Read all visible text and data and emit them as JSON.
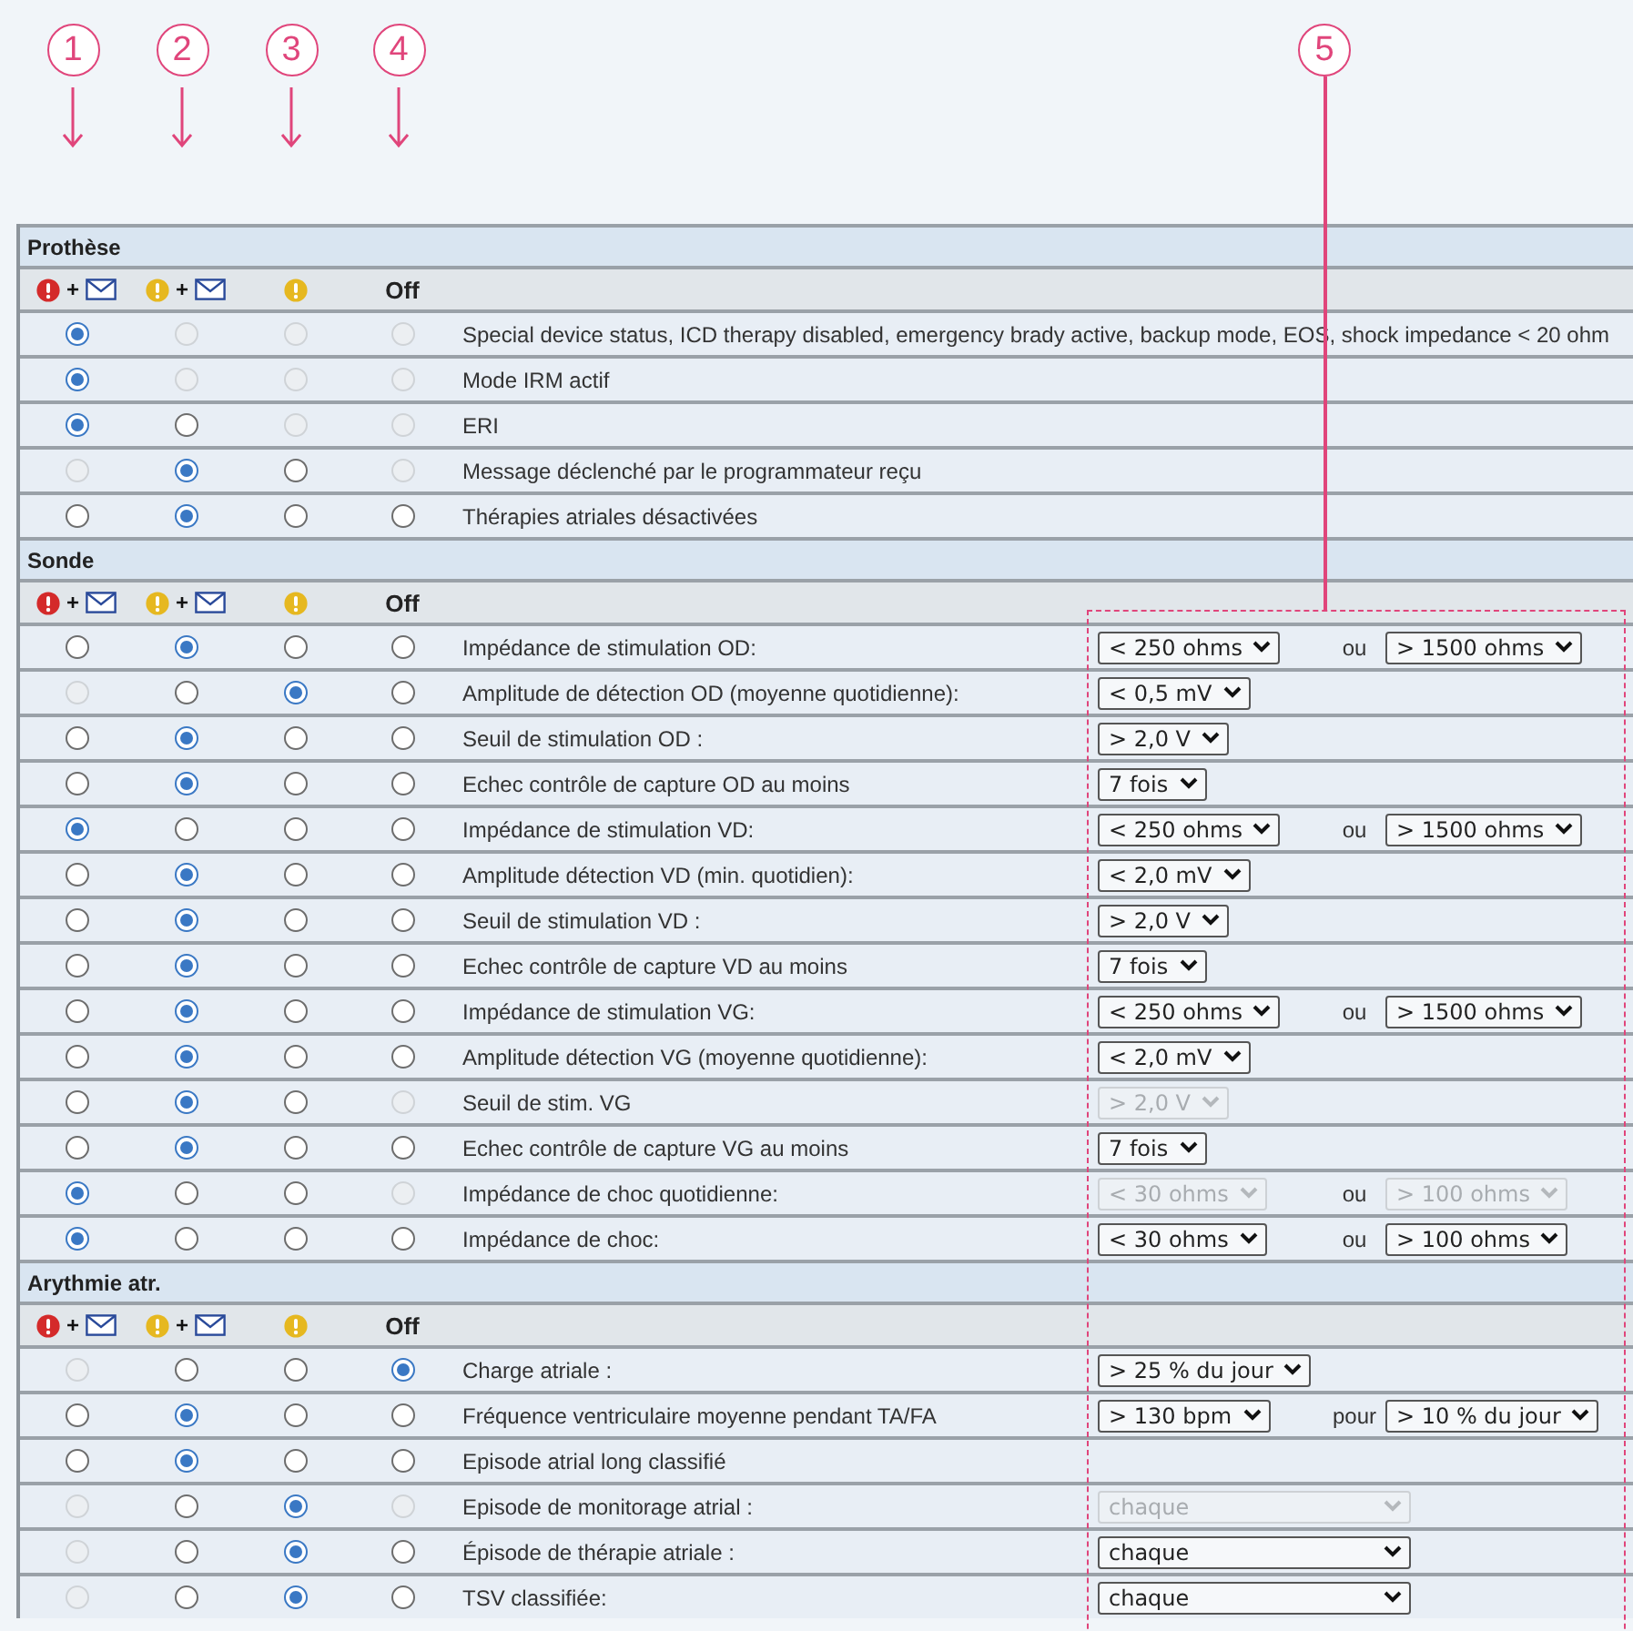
{
  "callouts": [
    {
      "number": "1",
      "kind": "arrow"
    },
    {
      "number": "2",
      "kind": "arrow"
    },
    {
      "number": "3",
      "kind": "arrow"
    },
    {
      "number": "4",
      "kind": "arrow"
    },
    {
      "number": "5",
      "kind": "frame"
    }
  ],
  "sections": [
    {
      "title": "Prothèse",
      "columns": [
        {
          "kind": "urgent-mail",
          "plus": "+"
        },
        {
          "kind": "warning-mail",
          "plus": "+"
        },
        {
          "kind": "warning"
        },
        {
          "kind": "text",
          "label": "Off"
        }
      ],
      "rows": [
        {
          "label": "Special device status, ICD therapy disabled, emergency brady active, backup mode, EOS, shock impedance < 20 ohm",
          "options": [
            {
              "selected": true,
              "disabled": false
            },
            {
              "selected": false,
              "disabled": true
            },
            {
              "selected": false,
              "disabled": true
            },
            {
              "selected": false,
              "disabled": true
            }
          ],
          "controls": []
        },
        {
          "label": "Mode IRM actif",
          "options": [
            {
              "selected": true,
              "disabled": false
            },
            {
              "selected": false,
              "disabled": true
            },
            {
              "selected": false,
              "disabled": true
            },
            {
              "selected": false,
              "disabled": true
            }
          ],
          "controls": []
        },
        {
          "label": "ERI",
          "options": [
            {
              "selected": true,
              "disabled": false
            },
            {
              "selected": false,
              "disabled": false
            },
            {
              "selected": false,
              "disabled": true
            },
            {
              "selected": false,
              "disabled": true
            }
          ],
          "controls": []
        },
        {
          "label": "Message déclenché par le programmateur reçu",
          "options": [
            {
              "selected": false,
              "disabled": true
            },
            {
              "selected": true,
              "disabled": false
            },
            {
              "selected": false,
              "disabled": false
            },
            {
              "selected": false,
              "disabled": true
            }
          ],
          "controls": []
        },
        {
          "label": "Thérapies atriales désactivées",
          "options": [
            {
              "selected": false,
              "disabled": false
            },
            {
              "selected": true,
              "disabled": false
            },
            {
              "selected": false,
              "disabled": false
            },
            {
              "selected": false,
              "disabled": false
            }
          ],
          "controls": []
        }
      ]
    },
    {
      "title": "Sonde",
      "columns": [
        {
          "kind": "urgent-mail",
          "plus": "+"
        },
        {
          "kind": "warning-mail",
          "plus": "+"
        },
        {
          "kind": "warning"
        },
        {
          "kind": "text",
          "label": "Off"
        }
      ],
      "rows": [
        {
          "label": "Impédance de stimulation OD:",
          "options": [
            {
              "selected": false,
              "disabled": false
            },
            {
              "selected": true,
              "disabled": false
            },
            {
              "selected": false,
              "disabled": false
            },
            {
              "selected": false,
              "disabled": false
            }
          ],
          "controls": [
            {
              "kind": "select",
              "value": "< 250 ohms",
              "disabled": false
            },
            {
              "kind": "text",
              "label": "ou"
            },
            {
              "kind": "select",
              "value": "> 1500 ohms",
              "disabled": false
            }
          ]
        },
        {
          "label": "Amplitude de détection OD (moyenne quotidienne):",
          "options": [
            {
              "selected": false,
              "disabled": true
            },
            {
              "selected": false,
              "disabled": false
            },
            {
              "selected": true,
              "disabled": false
            },
            {
              "selected": false,
              "disabled": false
            }
          ],
          "controls": [
            {
              "kind": "select",
              "value": "< 0,5 mV",
              "disabled": false
            }
          ]
        },
        {
          "label": "Seuil de stimulation OD :",
          "options": [
            {
              "selected": false,
              "disabled": false
            },
            {
              "selected": true,
              "disabled": false
            },
            {
              "selected": false,
              "disabled": false
            },
            {
              "selected": false,
              "disabled": false
            }
          ],
          "controls": [
            {
              "kind": "select",
              "value": "> 2,0 V",
              "disabled": false
            }
          ]
        },
        {
          "label": "Echec contrôle de capture OD au moins",
          "options": [
            {
              "selected": false,
              "disabled": false
            },
            {
              "selected": true,
              "disabled": false
            },
            {
              "selected": false,
              "disabled": false
            },
            {
              "selected": false,
              "disabled": false
            }
          ],
          "controls": [
            {
              "kind": "select",
              "value": "7 fois",
              "disabled": false
            }
          ]
        },
        {
          "label": "Impédance de stimulation VD:",
          "options": [
            {
              "selected": true,
              "disabled": false
            },
            {
              "selected": false,
              "disabled": false
            },
            {
              "selected": false,
              "disabled": false
            },
            {
              "selected": false,
              "disabled": false
            }
          ],
          "controls": [
            {
              "kind": "select",
              "value": "< 250 ohms",
              "disabled": false
            },
            {
              "kind": "text",
              "label": "ou"
            },
            {
              "kind": "select",
              "value": "> 1500 ohms",
              "disabled": false
            }
          ]
        },
        {
          "label": "Amplitude détection VD (min. quotidien):",
          "options": [
            {
              "selected": false,
              "disabled": false
            },
            {
              "selected": true,
              "disabled": false
            },
            {
              "selected": false,
              "disabled": false
            },
            {
              "selected": false,
              "disabled": false
            }
          ],
          "controls": [
            {
              "kind": "select",
              "value": "< 2,0 mV",
              "disabled": false
            }
          ]
        },
        {
          "label": "Seuil de stimulation VD :",
          "options": [
            {
              "selected": false,
              "disabled": false
            },
            {
              "selected": true,
              "disabled": false
            },
            {
              "selected": false,
              "disabled": false
            },
            {
              "selected": false,
              "disabled": false
            }
          ],
          "controls": [
            {
              "kind": "select",
              "value": "> 2,0 V",
              "disabled": false
            }
          ]
        },
        {
          "label": "Echec contrôle de capture VD au moins",
          "options": [
            {
              "selected": false,
              "disabled": false
            },
            {
              "selected": true,
              "disabled": false
            },
            {
              "selected": false,
              "disabled": false
            },
            {
              "selected": false,
              "disabled": false
            }
          ],
          "controls": [
            {
              "kind": "select",
              "value": "7 fois",
              "disabled": false
            }
          ]
        },
        {
          "label": "Impédance de stimulation VG:",
          "options": [
            {
              "selected": false,
              "disabled": false
            },
            {
              "selected": true,
              "disabled": false
            },
            {
              "selected": false,
              "disabled": false
            },
            {
              "selected": false,
              "disabled": false
            }
          ],
          "controls": [
            {
              "kind": "select",
              "value": "< 250 ohms",
              "disabled": false
            },
            {
              "kind": "text",
              "label": "ou"
            },
            {
              "kind": "select",
              "value": "> 1500 ohms",
              "disabled": false
            }
          ]
        },
        {
          "label": "Amplitude détection VG (moyenne quotidienne):",
          "options": [
            {
              "selected": false,
              "disabled": false
            },
            {
              "selected": true,
              "disabled": false
            },
            {
              "selected": false,
              "disabled": false
            },
            {
              "selected": false,
              "disabled": false
            }
          ],
          "controls": [
            {
              "kind": "select",
              "value": "< 2,0 mV",
              "disabled": false
            }
          ]
        },
        {
          "label": "Seuil de stim. VG",
          "options": [
            {
              "selected": false,
              "disabled": false
            },
            {
              "selected": true,
              "disabled": false
            },
            {
              "selected": false,
              "disabled": false
            },
            {
              "selected": false,
              "disabled": true
            }
          ],
          "controls": [
            {
              "kind": "select",
              "value": "> 2,0 V",
              "disabled": true
            }
          ]
        },
        {
          "label": "Echec contrôle de capture VG au moins",
          "options": [
            {
              "selected": false,
              "disabled": false
            },
            {
              "selected": true,
              "disabled": false
            },
            {
              "selected": false,
              "disabled": false
            },
            {
              "selected": false,
              "disabled": false
            }
          ],
          "controls": [
            {
              "kind": "select",
              "value": "7 fois",
              "disabled": false
            }
          ]
        },
        {
          "label": "Impédance de choc quotidienne:",
          "options": [
            {
              "selected": true,
              "disabled": false
            },
            {
              "selected": false,
              "disabled": false
            },
            {
              "selected": false,
              "disabled": false
            },
            {
              "selected": false,
              "disabled": true
            }
          ],
          "controls": [
            {
              "kind": "select",
              "value": "< 30 ohms",
              "disabled": true
            },
            {
              "kind": "text",
              "label": "ou"
            },
            {
              "kind": "select",
              "value": "> 100 ohms",
              "disabled": true
            }
          ]
        },
        {
          "label": "Impédance de choc:",
          "options": [
            {
              "selected": true,
              "disabled": false
            },
            {
              "selected": false,
              "disabled": false
            },
            {
              "selected": false,
              "disabled": false
            },
            {
              "selected": false,
              "disabled": false
            }
          ],
          "controls": [
            {
              "kind": "select",
              "value": "< 30 ohms",
              "disabled": false
            },
            {
              "kind": "text",
              "label": "ou"
            },
            {
              "kind": "select",
              "value": "> 100 ohms",
              "disabled": false
            }
          ]
        }
      ]
    },
    {
      "title": "Arythmie atr.",
      "columns": [
        {
          "kind": "urgent-mail",
          "plus": "+"
        },
        {
          "kind": "warning-mail",
          "plus": "+"
        },
        {
          "kind": "warning"
        },
        {
          "kind": "text",
          "label": "Off"
        }
      ],
      "rows": [
        {
          "label": "Charge atriale :",
          "options": [
            {
              "selected": false,
              "disabled": true
            },
            {
              "selected": false,
              "disabled": false
            },
            {
              "selected": false,
              "disabled": false
            },
            {
              "selected": true,
              "disabled": false
            }
          ],
          "controls": [
            {
              "kind": "select",
              "value": "> 25 % du jour",
              "disabled": false
            }
          ]
        },
        {
          "label": "Fréquence ventriculaire moyenne pendant TA/FA",
          "options": [
            {
              "selected": false,
              "disabled": false
            },
            {
              "selected": true,
              "disabled": false
            },
            {
              "selected": false,
              "disabled": false
            },
            {
              "selected": false,
              "disabled": false
            }
          ],
          "controls": [
            {
              "kind": "select",
              "value": "> 130 bpm",
              "disabled": false
            },
            {
              "kind": "text",
              "label": "pour"
            },
            {
              "kind": "select",
              "value": "> 10 % du jour",
              "disabled": false
            }
          ]
        },
        {
          "label": "Episode atrial long classifié",
          "options": [
            {
              "selected": false,
              "disabled": false
            },
            {
              "selected": true,
              "disabled": false
            },
            {
              "selected": false,
              "disabled": false
            },
            {
              "selected": false,
              "disabled": false
            }
          ],
          "controls": []
        },
        {
          "label": "Episode de monitorage atrial :",
          "options": [
            {
              "selected": false,
              "disabled": true
            },
            {
              "selected": false,
              "disabled": false
            },
            {
              "selected": true,
              "disabled": false
            },
            {
              "selected": false,
              "disabled": true
            }
          ],
          "controls": [
            {
              "kind": "list-select",
              "value": "chaque",
              "disabled": true
            }
          ]
        },
        {
          "label": "Épisode de thérapie atriale :",
          "options": [
            {
              "selected": false,
              "disabled": true
            },
            {
              "selected": false,
              "disabled": false
            },
            {
              "selected": true,
              "disabled": false
            },
            {
              "selected": false,
              "disabled": false
            }
          ],
          "controls": [
            {
              "kind": "list-select",
              "value": "chaque",
              "disabled": false
            }
          ]
        },
        {
          "label": "TSV classifiée:",
          "options": [
            {
              "selected": false,
              "disabled": true
            },
            {
              "selected": false,
              "disabled": false
            },
            {
              "selected": true,
              "disabled": false
            },
            {
              "selected": false,
              "disabled": false
            }
          ],
          "controls": [
            {
              "kind": "list-select",
              "value": "chaque",
              "disabled": false
            }
          ]
        }
      ]
    }
  ]
}
